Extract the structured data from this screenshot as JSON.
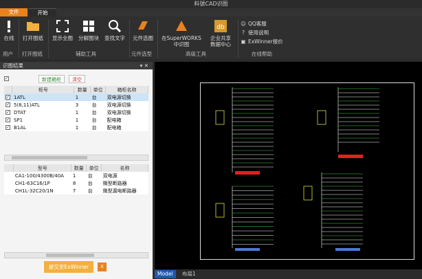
{
  "app": {
    "title": "料號CAD识图"
  },
  "tabs": {
    "file": "文件",
    "start": "开始"
  },
  "ribbon": {
    "offline": "在线",
    "open_drawing": "打开图纸",
    "show_all": "显示全图",
    "explode": "分解图块",
    "find_text": "查找文字",
    "component_select": "元件选图",
    "superworks_line1": "在SuperWORKS",
    "superworks_line2": "中识图",
    "enterprise_line1": "企业共享",
    "enterprise_line2": "数据中心",
    "qq": "QQ客服",
    "help": "使用说明",
    "exwinner": "ExWinner报价",
    "groups": {
      "user": "用户",
      "open": "打开图纸",
      "aux": "辅助工具",
      "component": "元件选型",
      "advanced": "高级工具",
      "online": "在线帮助"
    }
  },
  "panel": {
    "title": "识图结果",
    "pin": "▾ ✕",
    "new_cabinet": "新建箱柜",
    "clear": "清空",
    "table1": {
      "headers": [
        "柜号",
        "数量",
        "单位",
        "箱柜名称"
      ],
      "rows": [
        {
          "name": "1ATL",
          "qty": "1",
          "unit": "台",
          "desc": "双电源切换"
        },
        {
          "name": "5(8,11)ATL",
          "qty": "3",
          "unit": "台",
          "desc": "双电源切换"
        },
        {
          "name": "DTAT",
          "qty": "1",
          "unit": "台",
          "desc": "双电源切换"
        },
        {
          "name": "SP1",
          "qty": "1",
          "unit": "台",
          "desc": "配电箱"
        },
        {
          "name": "B1AL",
          "qty": "1",
          "unit": "台",
          "desc": "配电箱"
        }
      ]
    },
    "table2": {
      "headers": [
        "型号",
        "数量",
        "单位",
        "名称"
      ],
      "rows": [
        {
          "model": "CA1-100/4300B/40A",
          "qty": "1",
          "unit": "台",
          "name": "双电源"
        },
        {
          "model": "CH1-63C16/1P",
          "qty": "8",
          "unit": "台",
          "name": "微型断路器"
        },
        {
          "model": "CH1L-32C20/1N",
          "qty": "7",
          "unit": "台",
          "name": "微型漏电断路器"
        }
      ]
    },
    "submit": "提交至ExWinner"
  },
  "bottom": {
    "model": "Model",
    "layout": "布局1"
  },
  "colors": {
    "accent": "#e8821e",
    "selection": "#cde4f7",
    "model_tab": "#1e5aa8"
  }
}
